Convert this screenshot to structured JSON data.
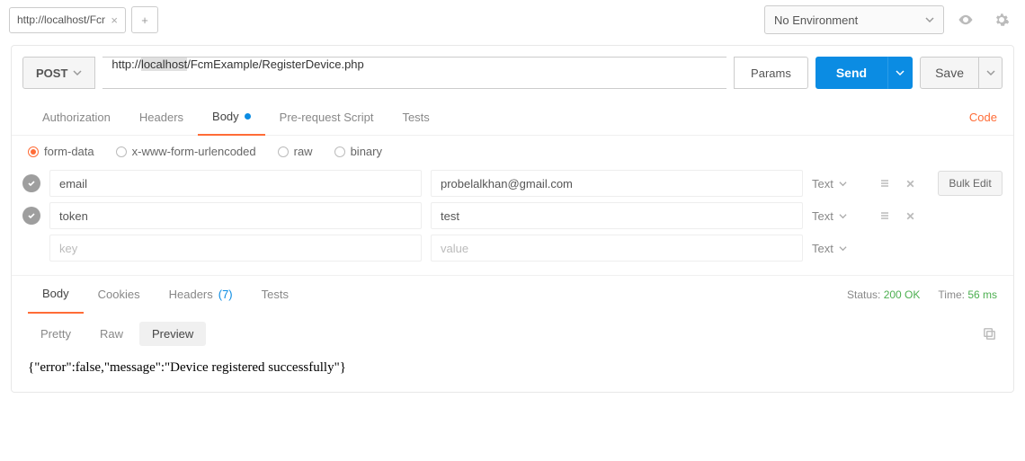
{
  "topbar": {
    "tab_label": "http://localhost/FcmE",
    "environment": "No Environment"
  },
  "request": {
    "method": "POST",
    "url_prefix": "http://",
    "url_selected": "localhost",
    "url_suffix": "/FcmExample/RegisterDevice.php",
    "params_label": "Params",
    "send_label": "Send",
    "save_label": "Save"
  },
  "req_tabs": {
    "authorization": "Authorization",
    "headers": "Headers",
    "body": "Body",
    "prerequest": "Pre-request Script",
    "tests": "Tests",
    "code": "Code"
  },
  "body_types": {
    "form_data": "form-data",
    "urlencoded": "x-www-form-urlencoded",
    "raw": "raw",
    "binary": "binary"
  },
  "kv": {
    "rows": [
      {
        "key": "email",
        "value": "probelalkhan@gmail.com",
        "type": "Text"
      },
      {
        "key": "token",
        "value": "test",
        "type": "Text"
      }
    ],
    "placeholder_key": "key",
    "placeholder_value": "value",
    "placeholder_type": "Text",
    "bulk_edit": "Bulk Edit"
  },
  "resp_tabs": {
    "body": "Body",
    "cookies": "Cookies",
    "headers": "Headers",
    "headers_count": "(7)",
    "tests": "Tests"
  },
  "status": {
    "status_label": "Status:",
    "status_value": "200 OK",
    "time_label": "Time:",
    "time_value": "56 ms"
  },
  "view_modes": {
    "pretty": "Pretty",
    "raw": "Raw",
    "preview": "Preview"
  },
  "preview_body": "{\"error\":false,\"message\":\"Device registered successfully\"}"
}
